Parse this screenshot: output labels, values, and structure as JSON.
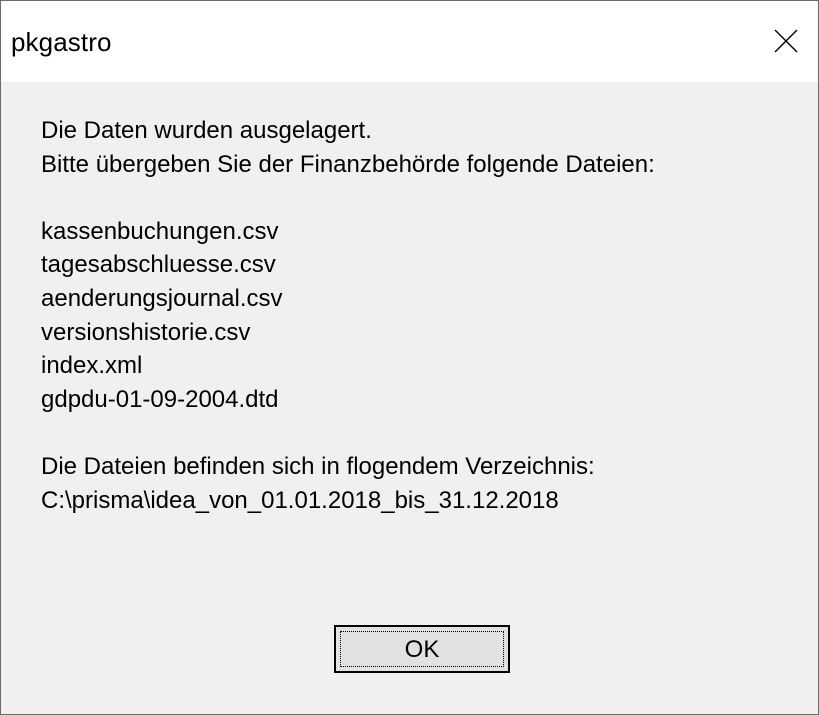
{
  "window": {
    "title": "pkgastro"
  },
  "message": {
    "intro_line1": "Die Daten wurden ausgelagert.",
    "intro_line2": "Bitte übergeben Sie der Finanzbehörde folgende Dateien:",
    "files": [
      "kassenbuchungen.csv",
      "tagesabschluesse.csv",
      "aenderungsjournal.csv",
      "versionshistorie.csv",
      "index.xml",
      "gdpdu-01-09-2004.dtd"
    ],
    "location_line": "Die Dateien befinden sich in flogendem Verzeichnis:",
    "path": "C:\\prisma\\idea_von_01.01.2018_bis_31.12.2018"
  },
  "buttons": {
    "ok_label": "OK"
  },
  "icons": {
    "close": "close-icon"
  }
}
